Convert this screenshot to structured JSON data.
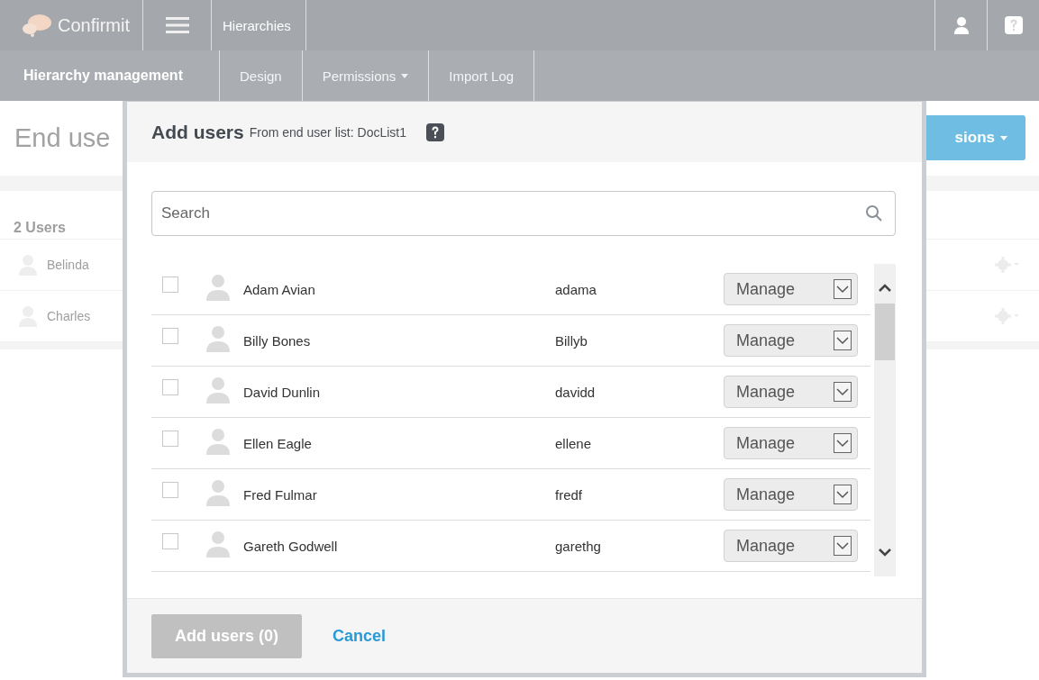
{
  "app_bar": {
    "logo_text": "Confirmit",
    "section": "Hierarchies"
  },
  "sub_bar": {
    "title": "Hierarchy management",
    "tabs": [
      {
        "label": "Design",
        "dropdown": false
      },
      {
        "label": "Permissions",
        "dropdown": true
      },
      {
        "label": "Import Log",
        "dropdown": false
      }
    ]
  },
  "page": {
    "title": "End use",
    "action_button": "sions",
    "count": "2 Users",
    "users": [
      {
        "name": "Belinda"
      },
      {
        "name": "Charles"
      }
    ]
  },
  "dialog": {
    "title": "Add users",
    "subtitle": "From end user list: DocList1",
    "search": {
      "placeholder": "Search"
    },
    "users": [
      {
        "name": "Adam Avian",
        "login": "adama",
        "checked": false,
        "role": "Manage"
      },
      {
        "name": "Billy Bones",
        "login": "Billyb",
        "checked": false,
        "role": "Manage"
      },
      {
        "name": "David Dunlin",
        "login": "davidd",
        "checked": false,
        "role": "Manage"
      },
      {
        "name": "Ellen Eagle",
        "login": "ellene",
        "checked": false,
        "role": "Manage"
      },
      {
        "name": "Fred Fulmar",
        "login": "fredf",
        "checked": false,
        "role": "Manage"
      },
      {
        "name": "Gareth Godwell",
        "login": "garethg",
        "checked": false,
        "role": "Manage"
      }
    ],
    "primary_button": {
      "label": "Add users (0)",
      "disabled": true
    },
    "cancel_link": "Cancel"
  }
}
